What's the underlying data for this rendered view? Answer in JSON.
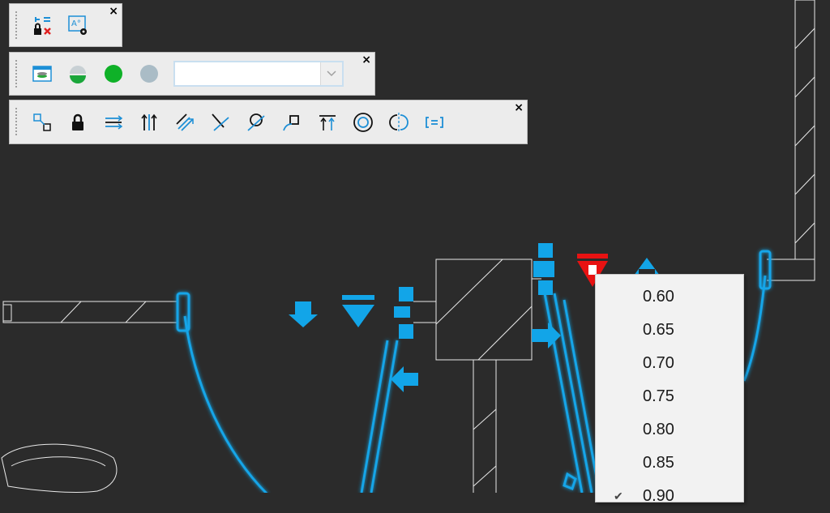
{
  "toolbars": {
    "toolbar1": {
      "buttons": [
        {
          "name": "constraint-lock-delete-icon",
          "title": "Delete constraints"
        },
        {
          "name": "text-settings-icon",
          "title": "Text settings"
        }
      ],
      "close_label": "×"
    },
    "toolbar2": {
      "buttons": [
        {
          "name": "window-layer-icon",
          "title": "Layer window"
        },
        {
          "name": "half-circle-layer-icon",
          "title": "Layer state"
        },
        {
          "name": "green-circle-icon",
          "title": "Layer on"
        },
        {
          "name": "gray-circle-icon",
          "title": "Layer off"
        }
      ],
      "combo_value": "",
      "close_label": "×"
    },
    "toolbar3": {
      "buttons": [
        {
          "name": "coincident-icon"
        },
        {
          "name": "lock-icon"
        },
        {
          "name": "horizontal-icon"
        },
        {
          "name": "vertical-icon"
        },
        {
          "name": "parallel-icon"
        },
        {
          "name": "perpendicular-icon"
        },
        {
          "name": "tangent-icon"
        },
        {
          "name": "smooth-icon"
        },
        {
          "name": "collinear-icon"
        },
        {
          "name": "concentric-icon"
        },
        {
          "name": "symmetric-icon"
        },
        {
          "name": "equal-icon"
        }
      ],
      "close_label": "×"
    }
  },
  "colors": {
    "background": "#2b2b2b",
    "cad_line": "#ffffff",
    "grip_blue": "#12a5e8",
    "grip_red": "#e81212"
  },
  "dropdown": {
    "items": [
      "0.60",
      "0.65",
      "0.70",
      "0.75",
      "0.80",
      "0.85",
      "0.90"
    ],
    "checked_item": "0.90"
  }
}
